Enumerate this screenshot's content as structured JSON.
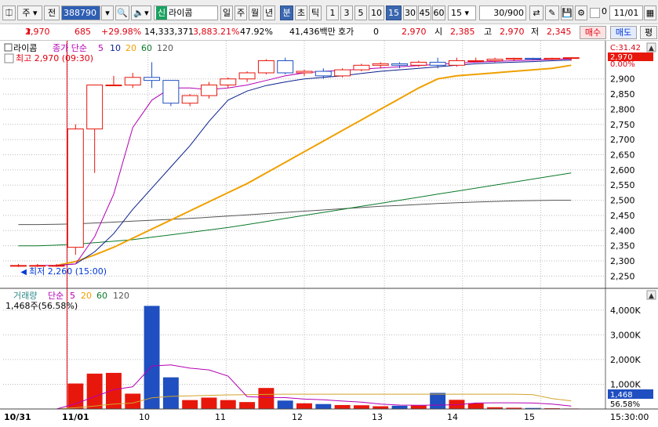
{
  "toolbar": {
    "market": "주",
    "prev_label": "전",
    "code": "388790",
    "tag": "신",
    "name": "라이콤",
    "periods": [
      "일",
      "주",
      "월",
      "년",
      "분",
      "초",
      "틱"
    ],
    "minutes": [
      "1",
      "3",
      "5",
      "10",
      "15",
      "30",
      "45",
      "60"
    ],
    "minute_select": "15",
    "count": "30",
    "count_total": "/900",
    "date": "11/01",
    "checkbox_label": "0"
  },
  "quote": {
    "price": "2,970",
    "change": "685",
    "change_pct": "+29.98%",
    "volume": "14,333,371",
    "volume_pct": "3,883.21%",
    "turnover_pct": "47.92%",
    "amount": "41,436백만",
    "hoga_label": "호가",
    "hoga_value": "0",
    "hoga_price": "2,970",
    "open_label": "시",
    "open": "2,385",
    "high_label": "고",
    "high": "2,970",
    "low_label": "저",
    "low": "2,345",
    "buy_label": "매수",
    "sell_label": "매도",
    "eval_label": "평"
  },
  "price_panel": {
    "legend_name": "라이콤",
    "legend_ma": "종가 단순",
    "ma_periods": [
      "5",
      "10",
      "20",
      "60",
      "120"
    ],
    "high_annot": "최고 2,970 (09:30)",
    "low_annot": "최저 2,260 (15:00)",
    "right_tag_top": "C:31.42",
    "right_price_tag": "2,970",
    "right_pct": "0.00%"
  },
  "volume_panel": {
    "legend_name": "거래량",
    "legend_ma": "단순",
    "ma_periods": [
      "5",
      "20",
      "60",
      "120"
    ],
    "current": "1,468주(56.58%)",
    "tag_value": "1,468",
    "tag_pct": "56.58%"
  },
  "time_axis": {
    "labels": [
      "10/31",
      "11/01",
      "10",
      "11",
      "12",
      "13",
      "14",
      "15"
    ],
    "end": "15:30:00"
  },
  "colors": {
    "up": "#e8170c",
    "down": "#1f4fc0",
    "ma5": "#b400b4",
    "ma10": "#0a1f8c",
    "ma20": "#f0a000",
    "ma60": "#0a7a2a",
    "ma120": "#555555"
  },
  "chart_data": {
    "type": "candlestick",
    "price_axis": {
      "ylim": [
        2220,
        3000
      ],
      "ticks": [
        2250,
        2300,
        2350,
        2400,
        2450,
        2500,
        2550,
        2600,
        2650,
        2700,
        2750,
        2800,
        2850,
        2900
      ]
    },
    "volume_axis": {
      "ylim": [
        0,
        4500
      ],
      "ticks": [
        1000,
        2000,
        3000,
        4000
      ],
      "tick_labels": [
        "1,000K",
        "2,000K",
        "3,000K",
        "4,000K"
      ]
    },
    "candles": [
      {
        "o": 2285,
        "h": 2290,
        "l": 2280,
        "c": 2285,
        "v": 0
      },
      {
        "o": 2285,
        "h": 2290,
        "l": 2280,
        "c": 2285,
        "v": 0
      },
      {
        "o": 2285,
        "h": 2290,
        "l": 2280,
        "c": 2285,
        "v": 0
      },
      {
        "o": 2345,
        "h": 2750,
        "l": 2320,
        "c": 2735,
        "v": 1030
      },
      {
        "o": 2735,
        "h": 2865,
        "l": 2590,
        "c": 2880,
        "v": 1430
      },
      {
        "o": 2880,
        "h": 2910,
        "l": 2880,
        "c": 2880,
        "v": 1460
      },
      {
        "o": 2880,
        "h": 2920,
        "l": 2870,
        "c": 2905,
        "v": 620
      },
      {
        "o": 2905,
        "h": 2955,
        "l": 2870,
        "c": 2895,
        "v": 4170
      },
      {
        "o": 2895,
        "h": 2895,
        "l": 2810,
        "c": 2820,
        "v": 1280
      },
      {
        "o": 2820,
        "h": 2850,
        "l": 2810,
        "c": 2845,
        "v": 360
      },
      {
        "o": 2845,
        "h": 2890,
        "l": 2835,
        "c": 2880,
        "v": 460
      },
      {
        "o": 2880,
        "h": 2905,
        "l": 2870,
        "c": 2900,
        "v": 360
      },
      {
        "o": 2900,
        "h": 2925,
        "l": 2890,
        "c": 2920,
        "v": 280
      },
      {
        "o": 2920,
        "h": 2965,
        "l": 2915,
        "c": 2960,
        "v": 850
      },
      {
        "o": 2960,
        "h": 2970,
        "l": 2915,
        "c": 2920,
        "v": 340
      },
      {
        "o": 2920,
        "h": 2930,
        "l": 2910,
        "c": 2925,
        "v": 230
      },
      {
        "o": 2925,
        "h": 2935,
        "l": 2900,
        "c": 2910,
        "v": 200
      },
      {
        "o": 2910,
        "h": 2935,
        "l": 2905,
        "c": 2930,
        "v": 160
      },
      {
        "o": 2930,
        "h": 2950,
        "l": 2925,
        "c": 2945,
        "v": 150
      },
      {
        "o": 2945,
        "h": 2955,
        "l": 2935,
        "c": 2950,
        "v": 110
      },
      {
        "o": 2950,
        "h": 2955,
        "l": 2935,
        "c": 2945,
        "v": 130
      },
      {
        "o": 2945,
        "h": 2960,
        "l": 2940,
        "c": 2955,
        "v": 140
      },
      {
        "o": 2955,
        "h": 2970,
        "l": 2935,
        "c": 2945,
        "v": 650
      },
      {
        "o": 2945,
        "h": 2970,
        "l": 2940,
        "c": 2960,
        "v": 370
      },
      {
        "o": 2960,
        "h": 2970,
        "l": 2955,
        "c": 2960,
        "v": 230
      },
      {
        "o": 2960,
        "h": 2970,
        "l": 2955,
        "c": 2965,
        "v": 70
      },
      {
        "o": 2965,
        "h": 2970,
        "l": 2960,
        "c": 2968,
        "v": 50
      },
      {
        "o": 2968,
        "h": 2970,
        "l": 2962,
        "c": 2965,
        "v": 40
      },
      {
        "o": 2965,
        "h": 2970,
        "l": 2962,
        "c": 2968,
        "v": 30
      },
      {
        "o": 2968,
        "h": 2970,
        "l": 2960,
        "c": 2970,
        "v": 20
      }
    ],
    "ma5": [
      null,
      2285,
      2285,
      2290,
      2380,
      2520,
      2740,
      2830,
      2870,
      2870,
      2865,
      2870,
      2880,
      2895,
      2910,
      2920,
      2925,
      2928,
      2932,
      2936,
      2940,
      2944,
      2948,
      2952,
      2955,
      2958,
      2960,
      2962,
      2964,
      2966
    ],
    "ma10": [
      null,
      null,
      2285,
      2290,
      2330,
      2390,
      2470,
      2540,
      2610,
      2680,
      2760,
      2830,
      2860,
      2878,
      2890,
      2900,
      2905,
      2910,
      2918,
      2925,
      2930,
      2935,
      2940,
      2945,
      2950,
      2953,
      2955,
      2957,
      2960,
      2962
    ],
    "ma20": [
      null,
      null,
      2285,
      2298,
      2320,
      2345,
      2375,
      2405,
      2435,
      2465,
      2495,
      2525,
      2555,
      2590,
      2625,
      2660,
      2695,
      2730,
      2765,
      2800,
      2835,
      2870,
      2900,
      2910,
      2915,
      2920,
      2925,
      2930,
      2935,
      2945
    ],
    "ma60": [
      2350,
      2350,
      2352,
      2355,
      2360,
      2365,
      2370,
      2378,
      2386,
      2394,
      2402,
      2410,
      2420,
      2430,
      2440,
      2450,
      2460,
      2470,
      2480,
      2490,
      2500,
      2510,
      2520,
      2530,
      2540,
      2550,
      2560,
      2570,
      2580,
      2590
    ],
    "ma120": [
      2420,
      2420,
      2421,
      2422,
      2425,
      2428,
      2431,
      2434,
      2437,
      2440,
      2444,
      2448,
      2452,
      2456,
      2460,
      2464,
      2468,
      2472,
      2476,
      2480,
      2483,
      2486,
      2489,
      2492,
      2494,
      2496,
      2498,
      2499,
      2500,
      2500
    ],
    "vma5": [
      0,
      0,
      0,
      210,
      500,
      780,
      900,
      1740,
      1780,
      1650,
      1580,
      1330,
      500,
      470,
      460,
      400,
      370,
      320,
      280,
      200,
      160,
      150,
      160,
      170,
      240,
      250,
      250,
      240,
      200,
      120
    ],
    "vma20": [
      0,
      0,
      0,
      50,
      120,
      200,
      240,
      450,
      510,
      530,
      550,
      570,
      580,
      590,
      600,
      600,
      600,
      600,
      600,
      600,
      600,
      600,
      600,
      600,
      600,
      600,
      600,
      580,
      420,
      330
    ]
  }
}
